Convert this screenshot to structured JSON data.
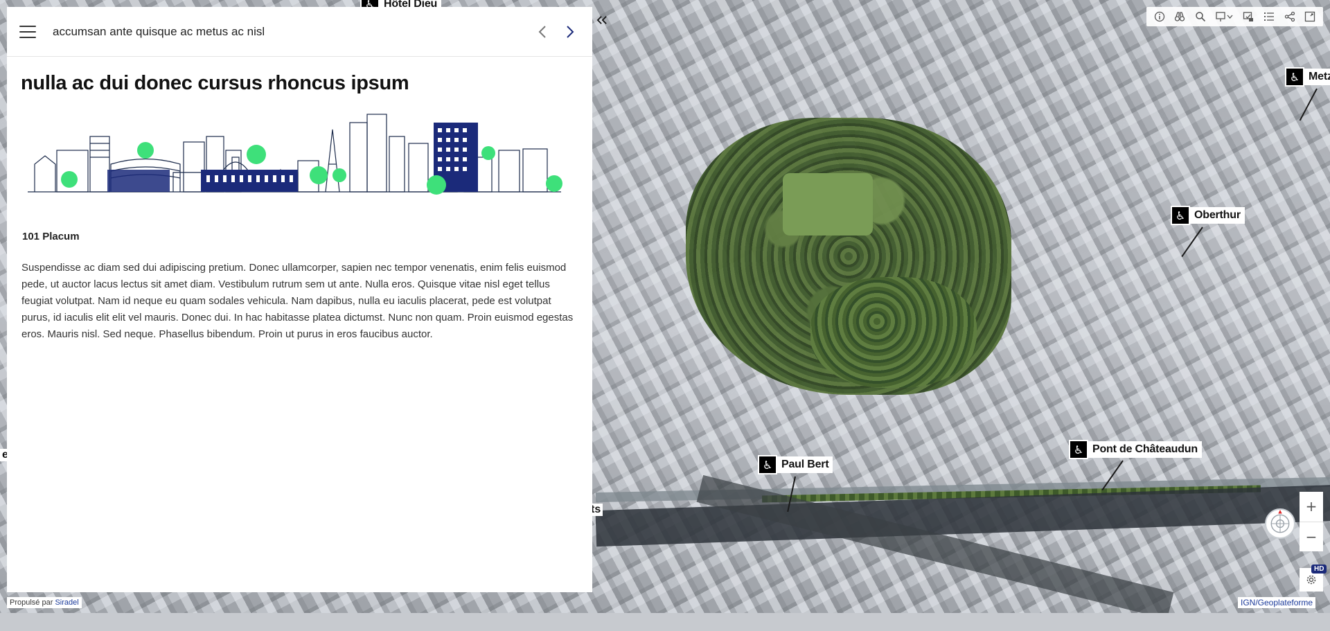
{
  "panel": {
    "header_title": "accumsan ante quisque ac metus ac nisl",
    "heading": "nulla ac dui donec cursus rhoncus ipsum",
    "subheading": "101 Placum",
    "paragraph": "Suspendisse ac diam sed dui adipiscing pretium. Donec ullamcorper, sapien nec tempor venenatis, enim felis euismod pede, ut auctor lacus lectus sit amet diam. Vestibulum rutrum sem ut ante. Nulla eros. Quisque vitae nisl eget tellus feugiat volutpat. Nam id neque eu quam sodales vehicula. Nam dapibus, nulla eu iaculis placerat, pede est volutpat purus, id iaculis elit elit vel mauris. Donec dui. In hac habitasse platea dictumst. Nunc non quam. Proin euismod egestas eros. Mauris nisl. Sed neque. Phasellus bibendum. Proin ut purus in eros faucibus auctor."
  },
  "map": {
    "markers": [
      {
        "label": "Hôtel Dieu",
        "icon": "bicycle-station-icon"
      },
      {
        "label": "Metz",
        "icon": "bicycle-station-icon"
      },
      {
        "label": "Oberthur",
        "icon": "bicycle-station-icon"
      },
      {
        "label": "Pont de Châteaudun",
        "icon": "bicycle-station-icon"
      },
      {
        "label": "Paul Bert",
        "icon": "bicycle-station-icon"
      }
    ],
    "edge_fragments": [
      "e",
      "ts"
    ],
    "hd_badge": "HD",
    "attribution_left_prefix": "Propulsé par",
    "attribution_left_link": "Siradel",
    "attribution_right": "IGN/Geoplateforme"
  },
  "toolbar": {
    "tools": [
      "info-icon",
      "binoculars-icon",
      "search-icon",
      "basemap-icon",
      "layers-icon",
      "legend-icon",
      "share-icon",
      "fullscreen-icon"
    ]
  },
  "zoom": {
    "in": "+",
    "out": "−"
  }
}
